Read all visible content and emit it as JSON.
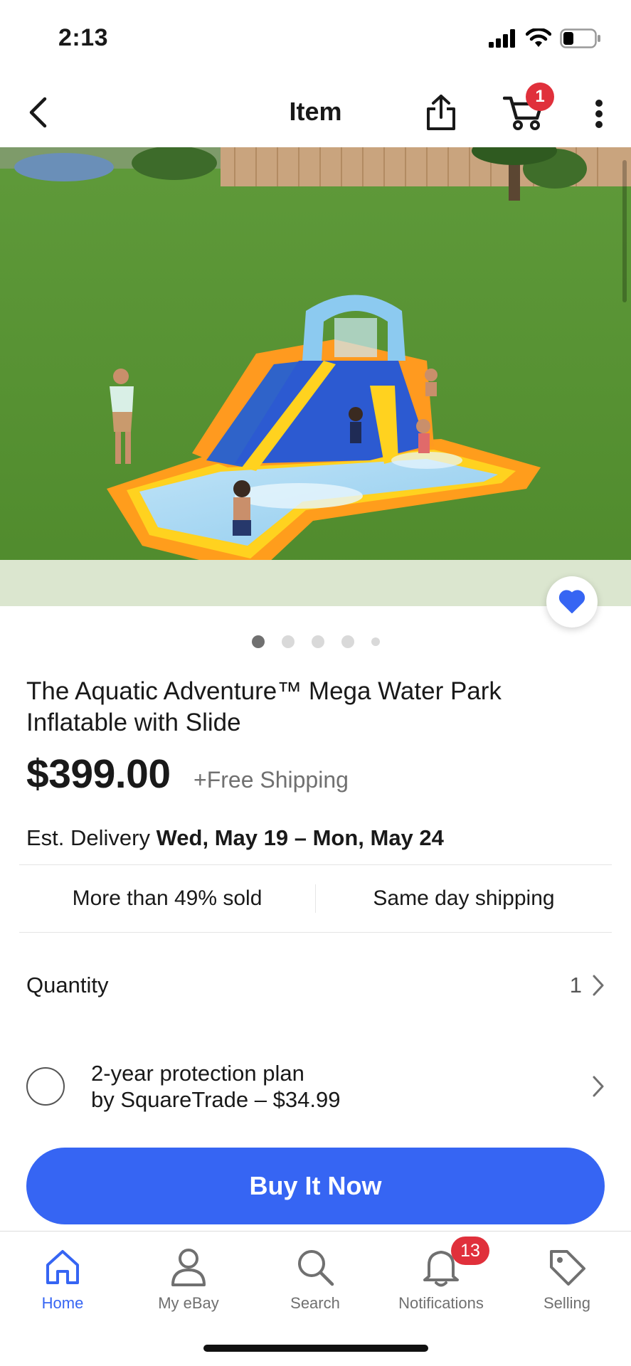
{
  "status_bar": {
    "time": "2:13"
  },
  "header": {
    "title": "Item",
    "cart_count": "1"
  },
  "image": {
    "alt": "Inflatable water park with slide in a backyard",
    "dots_count": 5,
    "active_dot": 0
  },
  "product": {
    "title": "The Aquatic Adventure™ Mega Water Park Inflatable  with Slide",
    "price": "$399.00",
    "shipping": "+Free Shipping",
    "delivery_label": "Est. Delivery",
    "delivery_dates": "Wed, May 19 – Mon, May 24"
  },
  "features": {
    "sold": "More than 49% sold",
    "shipping": "Same day shipping"
  },
  "quantity": {
    "label": "Quantity",
    "value": "1"
  },
  "protection": {
    "line1": "2-year protection plan",
    "line2": "by SquareTrade – $34.99"
  },
  "buy_button": "Buy It Now",
  "nav": {
    "items": [
      {
        "label": "Home",
        "icon": "home-icon",
        "active": true
      },
      {
        "label": "My eBay",
        "icon": "person-icon"
      },
      {
        "label": "Search",
        "icon": "search-icon"
      },
      {
        "label": "Notifications",
        "icon": "bell-icon"
      },
      {
        "label": "Selling",
        "icon": "tag-icon"
      }
    ],
    "notifications_count": "13"
  },
  "colors": {
    "accent": "#3665f3",
    "badge": "#e0303b",
    "text": "#191919",
    "muted": "#707070"
  }
}
